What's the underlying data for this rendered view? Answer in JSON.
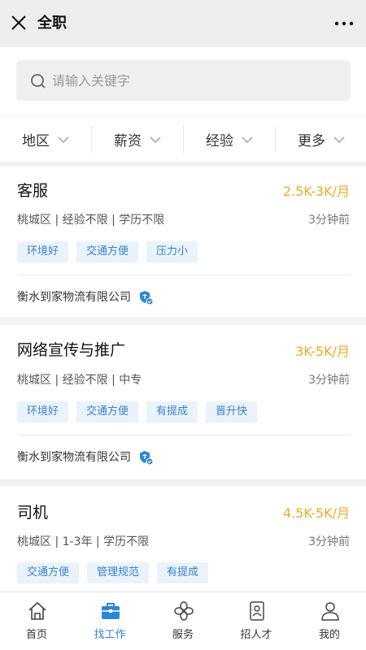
{
  "header": {
    "title": "全职"
  },
  "search": {
    "placeholder": "请输入关键字"
  },
  "filters": [
    "地区",
    "薪资",
    "经验",
    "更多"
  ],
  "jobs": [
    {
      "title": "客服",
      "salary": "2.5K-3K/月",
      "meta": "桃城区 | 经验不限 | 学历不限",
      "time": "3分钟前",
      "tags": [
        "环境好",
        "交通方便",
        "压力小"
      ],
      "company": "衡水到家物流有限公司"
    },
    {
      "title": "网络宣传与推广",
      "salary": "3K-5K/月",
      "meta": "桃城区 | 经验不限 | 中专",
      "time": "3分钟前",
      "tags": [
        "环境好",
        "交通方便",
        "有提成",
        "晋升快"
      ],
      "company": "衡水到家物流有限公司"
    },
    {
      "title": "司机",
      "salary": "4.5K-5K/月",
      "meta": "桃城区 | 1-3年 | 学历不限",
      "time": "3分钟前",
      "tags": [
        "交通方便",
        "管理规范",
        "有提成"
      ]
    }
  ],
  "tabbar": {
    "items": [
      {
        "label": "首页",
        "icon": "home-icon"
      },
      {
        "label": "找工作",
        "icon": "briefcase-icon",
        "active": true
      },
      {
        "label": "服务",
        "icon": "service-icon"
      },
      {
        "label": "招人才",
        "icon": "recruit-icon"
      },
      {
        "label": "我的",
        "icon": "user-icon"
      }
    ]
  },
  "colors": {
    "accent": "#2f86d6",
    "salary": "#f2a926",
    "tag_text": "#3a82c9",
    "tag_bg": "#eaf3fb"
  }
}
